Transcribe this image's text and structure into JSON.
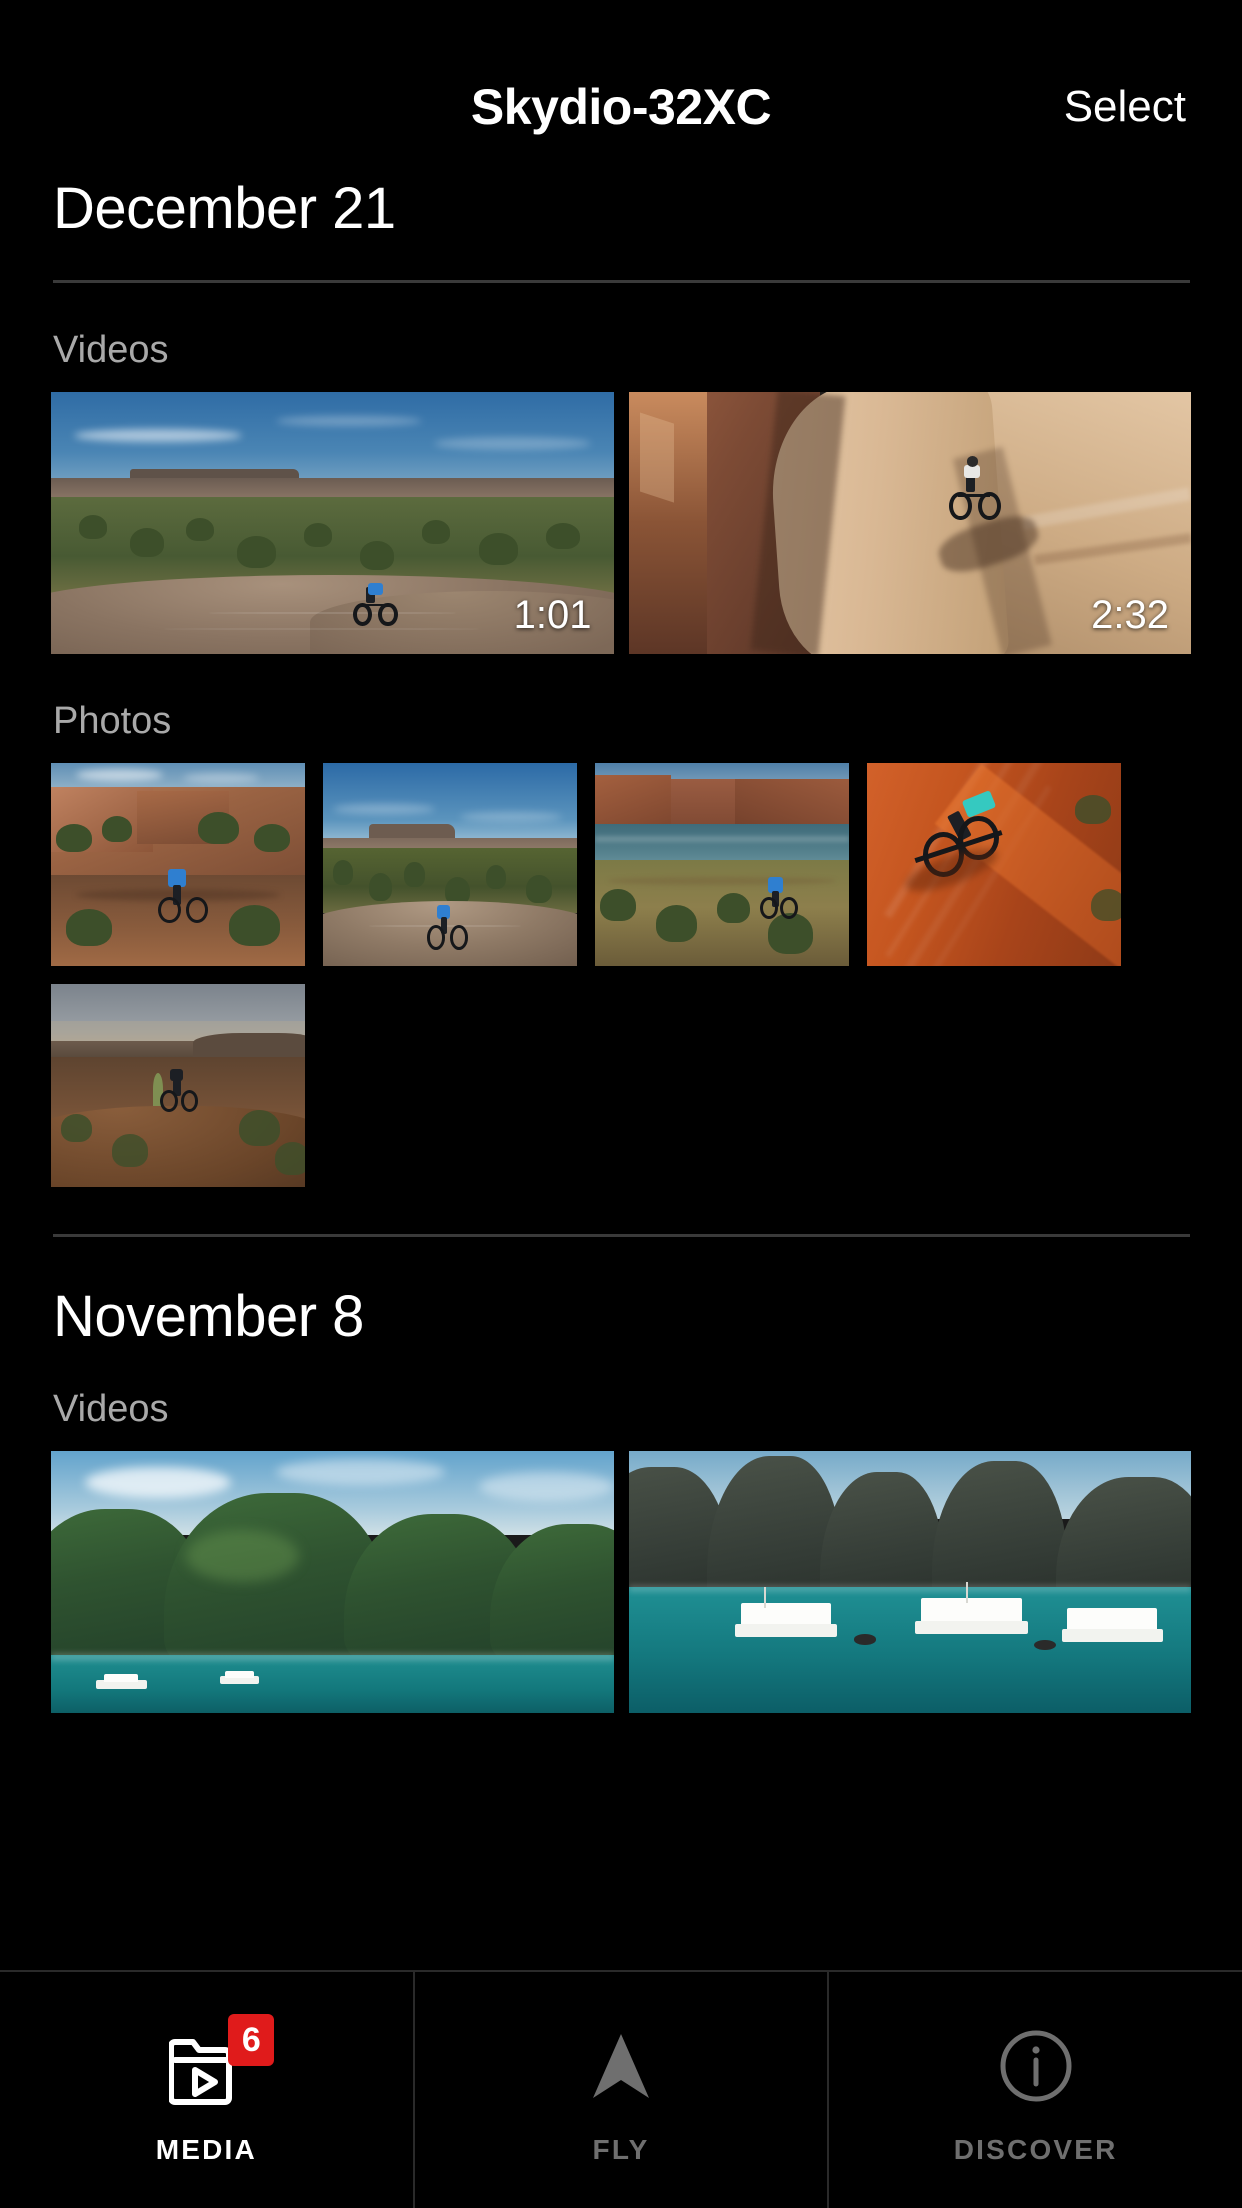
{
  "header": {
    "title": "Skydio-32XC",
    "select_label": "Select"
  },
  "sections": [
    {
      "date": "December 21",
      "videos_label": "Videos",
      "photos_label": "Photos",
      "videos": [
        {
          "duration": "1:01",
          "scene": "desert-mesa-valley-mountain-biker"
        },
        {
          "duration": "2:32",
          "scene": "slickrock-canyon-mountain-biker"
        }
      ],
      "photos": [
        {
          "scene": "red-rock-trail-biker"
        },
        {
          "scene": "desert-mesa-slickrock-biker"
        },
        {
          "scene": "river-canyon-biker"
        },
        {
          "scene": "orange-sand-dune-biker"
        },
        {
          "scene": "dusk-desert-biker"
        }
      ]
    },
    {
      "date": "November 8",
      "videos_label": "Videos",
      "videos": [
        {
          "scene": "tropical-island-lagoon-boats"
        },
        {
          "scene": "tropical-karst-bay-boats"
        }
      ]
    }
  ],
  "tabbar": {
    "tabs": [
      {
        "label": "MEDIA",
        "icon": "media-library-play-icon",
        "badge": "6",
        "active": true
      },
      {
        "label": "FLY",
        "icon": "navigation-arrow-icon",
        "badge": null,
        "active": false
      },
      {
        "label": "DISCOVER",
        "icon": "info-circle-icon",
        "badge": null,
        "active": false
      }
    ]
  },
  "colors": {
    "background": "#000000",
    "text_primary": "#ffffff",
    "text_secondary": "#a9a9a9",
    "text_muted": "#6f6f6f",
    "divider": "#3a3a3a",
    "badge_red": "#e01b1b"
  }
}
